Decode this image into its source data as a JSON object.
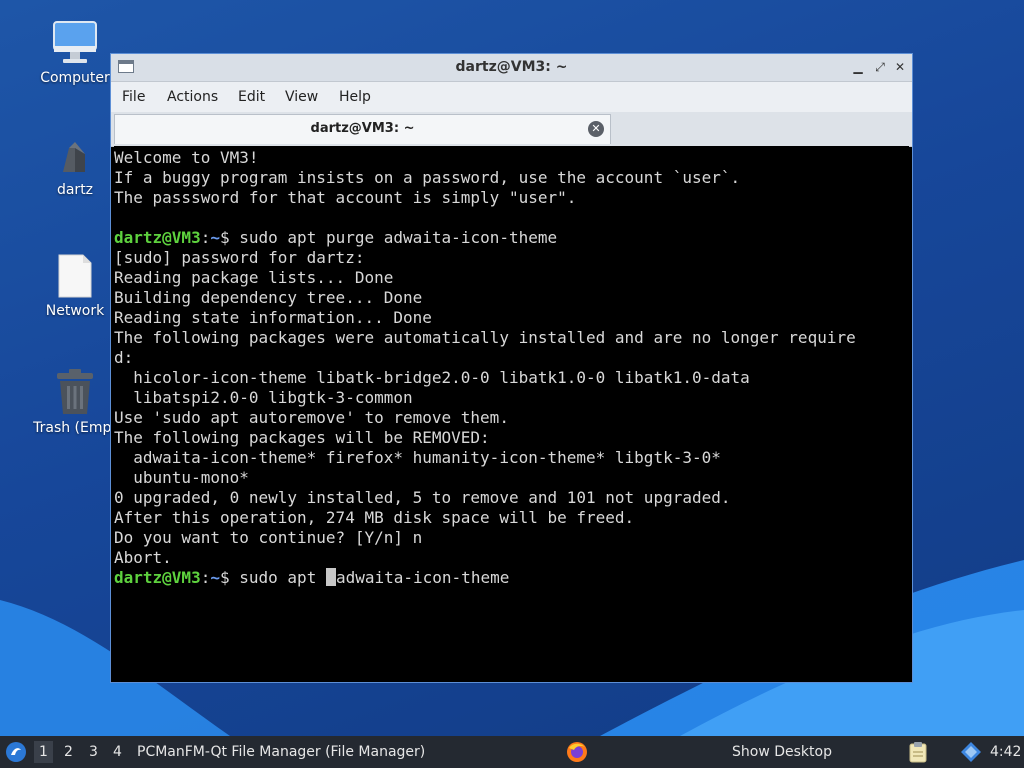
{
  "desktop": {
    "icons": [
      {
        "label": "Computer",
        "icon": "computer-icon"
      },
      {
        "label": "dartz",
        "icon": "home-folder-icon"
      },
      {
        "label": "Network",
        "icon": "network-icon"
      },
      {
        "label": "Trash (Empt",
        "icon": "trash-icon"
      }
    ]
  },
  "window": {
    "title": "dartz@VM3: ~",
    "controls": {
      "minimize": "▁",
      "maximize": "⤢",
      "close": "✕"
    },
    "menu": [
      "File",
      "Actions",
      "Edit",
      "View",
      "Help"
    ],
    "tab": {
      "label": "dartz@VM3: ~",
      "close": "✕"
    }
  },
  "terminal": {
    "prompt": {
      "user": "dartz@VM3",
      "colon": ":",
      "path": "~",
      "symbol": "$"
    },
    "lines": [
      "Welcome to VM3!",
      "If a buggy program insists on a password, use the account `user`.",
      "The passsword for that account is simply \"user\".",
      "",
      {
        "prompt": true,
        "cmd": " sudo apt purge adwaita-icon-theme"
      },
      "[sudo] password for dartz:",
      "Reading package lists... Done",
      "Building dependency tree... Done",
      "Reading state information... Done",
      "The following packages were automatically installed and are no longer require",
      "d:",
      "  hicolor-icon-theme libatk-bridge2.0-0 libatk1.0-0 libatk1.0-data",
      "  libatspi2.0-0 libgtk-3-common",
      "Use 'sudo apt autoremove' to remove them.",
      "The following packages will be REMOVED:",
      "  adwaita-icon-theme* firefox* humanity-icon-theme* libgtk-3-0*",
      "  ubuntu-mono*",
      "0 upgraded, 0 newly installed, 5 to remove and 101 not upgraded.",
      "After this operation, 274 MB disk space will be freed.",
      "Do you want to continue? [Y/n] n",
      "Abort.",
      {
        "prompt": true,
        "cmd_before": " sudo apt ",
        "cmd_after": "adwaita-icon-theme",
        "cursor": true
      }
    ]
  },
  "taskbar": {
    "workspaces": [
      "1",
      "2",
      "3",
      "4"
    ],
    "active_workspace": "1",
    "task": "PCManFM-Qt File Manager (File Manager)",
    "show_desktop": "Show Desktop",
    "clock": "4:42"
  },
  "colors": {
    "prompt_user": "#5ed23e",
    "prompt_path": "#6b9cf0",
    "terminal_bg": "#000000",
    "taskbar_bg": "#242931"
  }
}
